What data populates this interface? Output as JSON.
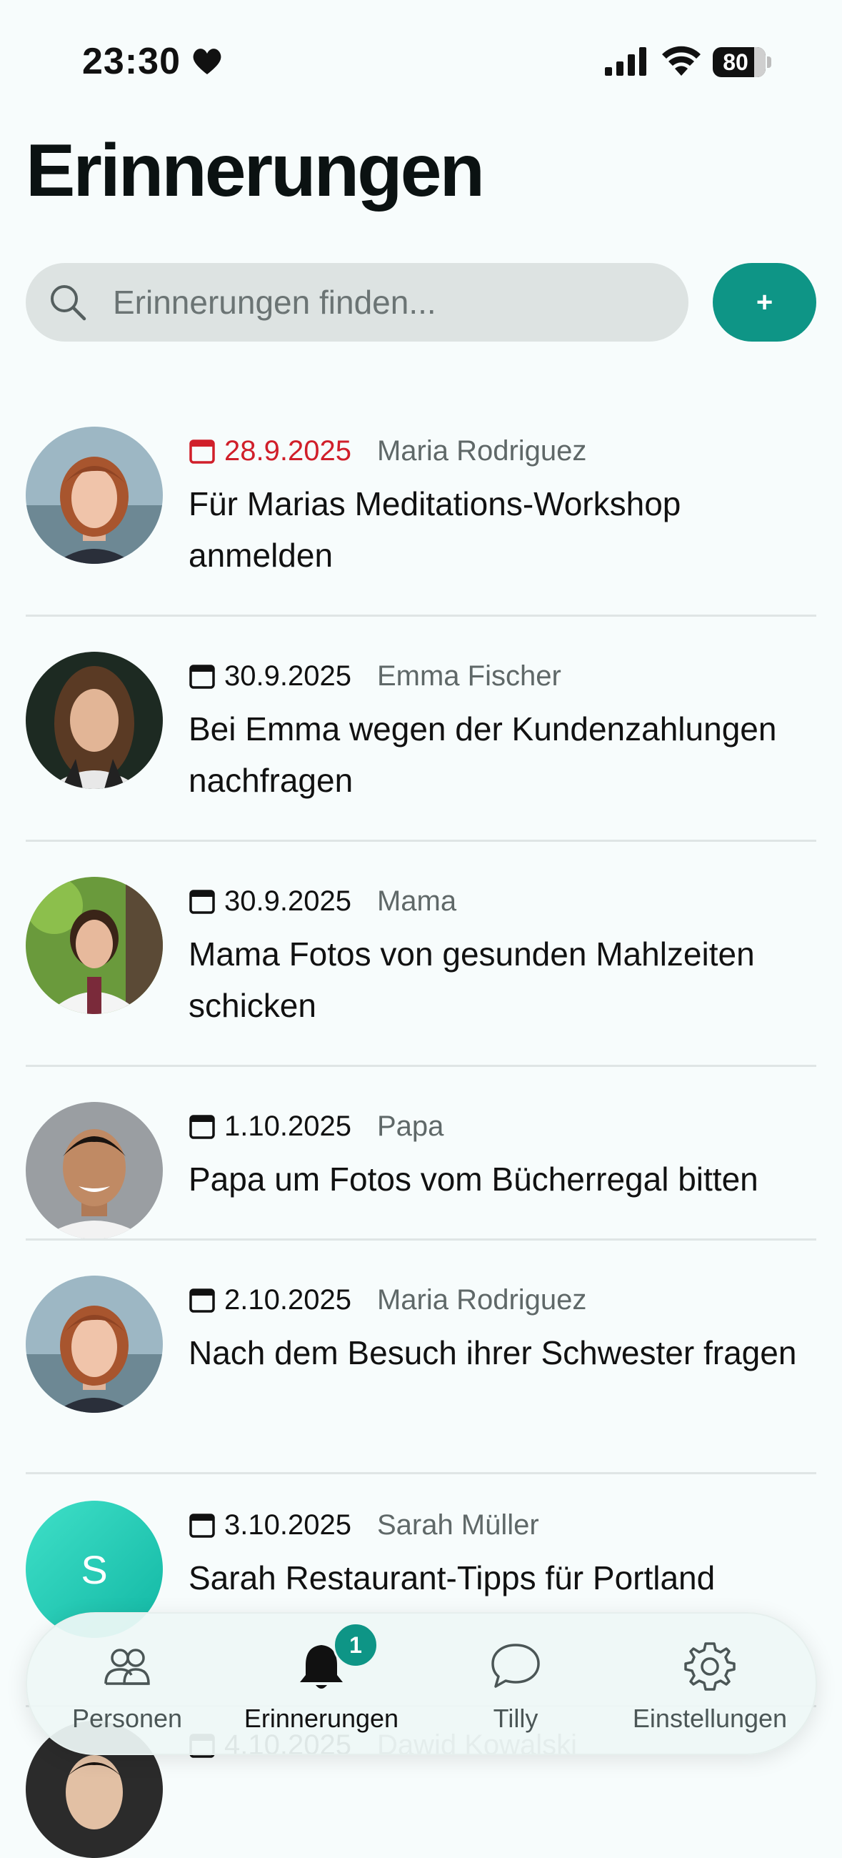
{
  "status_bar": {
    "time": "23:30",
    "battery": "80"
  },
  "page_title": "Erinnerungen",
  "search": {
    "placeholder": "Erinnerungen finden..."
  },
  "add_button": {
    "label": "+"
  },
  "reminders": [
    {
      "date": "28.9.2025",
      "person": "Maria Rodriguez",
      "text": "Für Marias Meditations-Workshop anmelden",
      "overdue": true
    },
    {
      "date": "30.9.2025",
      "person": "Emma Fischer",
      "text": "Bei Emma wegen der Kundenzahlungen nachfragen"
    },
    {
      "date": "30.9.2025",
      "person": "Mama",
      "text": "Mama Fotos von gesunden Mahlzeiten schicken"
    },
    {
      "date": "1.10.2025",
      "person": "Papa",
      "text": "Papa um Fotos vom Bücherregal bitten"
    },
    {
      "date": "2.10.2025",
      "person": "Maria Rodriguez",
      "text": "Nach dem Besuch ihrer Schwester fragen"
    },
    {
      "date": "3.10.2025",
      "person": "Sarah Müller",
      "text": "Sarah Restaurant-Tipps für Portland",
      "avatar_initial": "S"
    },
    {
      "date": "4.10.2025",
      "person": "Dawid Kowalski",
      "text": ""
    }
  ],
  "tabbar": {
    "tabs": [
      {
        "label": "Personen",
        "icon": "people-icon"
      },
      {
        "label": "Erinnerungen",
        "icon": "bell-icon",
        "badge": "1",
        "active": true
      },
      {
        "label": "Tilly",
        "icon": "chat-bubble-icon"
      },
      {
        "label": "Einstellungen",
        "icon": "gear-icon"
      }
    ]
  },
  "colors": {
    "accent": "#0e9586",
    "overdue": "#d01f2a",
    "background": "#f7fcfc"
  }
}
